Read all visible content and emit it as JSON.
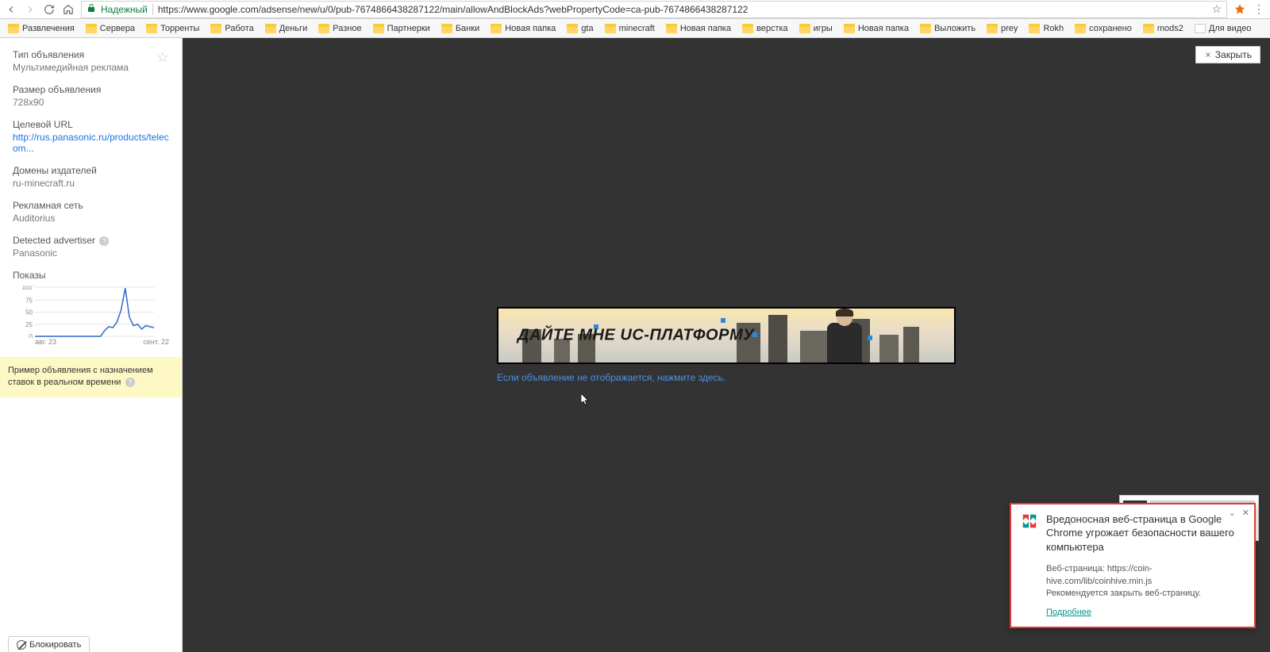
{
  "browser": {
    "secure_label": "Надежный",
    "url": "https://www.google.com/adsense/new/u/0/pub-7674866438287122/main/allowAndBlockAds?webPropertyCode=ca-pub-7674866438287122",
    "bookmarks": [
      "Развлечения",
      "Сервера",
      "Торренты",
      "Работа",
      "Деньги",
      "Разное",
      "Партнерки",
      "Банки",
      "Новая папка",
      "gta",
      "minecraft",
      "Новая папка",
      "верстка",
      "игры",
      "Новая папка",
      "Выложить",
      "prey",
      "Rokh",
      "сохранено",
      "mods2",
      "Для видео"
    ]
  },
  "sidebar": {
    "ad_type_label": "Тип объявления",
    "ad_type_value": "Мультимедийная реклама",
    "ad_size_label": "Размер объявления",
    "ad_size_value": "728x90",
    "target_url_label": "Целевой URL",
    "target_url_value": "http://rus.panasonic.ru/products/telecom...",
    "publisher_domains_label": "Домены издателей",
    "publisher_domains_value": "ru-minecraft.ru",
    "ad_network_label": "Рекламная сеть",
    "ad_network_value": "Auditorius",
    "detected_advertiser_label": "Detected advertiser",
    "detected_advertiser_value": "Panasonic",
    "impressions_label": "Показы",
    "note": "Пример объявления с назначением ставок в реальном времени",
    "chart_x_start": "авг. 23",
    "chart_x_end": "сент. 22"
  },
  "chart_data": {
    "type": "line",
    "title": "",
    "xlabel": "",
    "ylabel": "",
    "y_ticks": [
      102,
      75,
      50,
      25,
      0
    ],
    "ylim": [
      0,
      102
    ],
    "categories_label_start": "авг. 23",
    "categories_label_end": "сент. 22",
    "series": [
      {
        "name": "Показы",
        "values": [
          0,
          0,
          0,
          0,
          0,
          0,
          0,
          0,
          0,
          0,
          0,
          0,
          0,
          0,
          0,
          0,
          0,
          12,
          20,
          18,
          30,
          55,
          100,
          40,
          22,
          25,
          15,
          22,
          20,
          18
        ]
      }
    ]
  },
  "preview": {
    "close_label": "Закрыть",
    "ad_headline": "ДАЙТЕ МНЕ UC-ПЛАТФОРМУ",
    "fallback_link": "Если объявление не отображается, нажмите здесь."
  },
  "kaspersky": {
    "title": "Вредоносная веб-страница в Google Chrome угрожает безопасности вашего компьютера",
    "page_label": "Веб-страница: https://coin-hive.com/lib/coinhive.min.js",
    "advice": "Рекомендуется закрыть веб-страницу.",
    "more_link": "Подробнее"
  },
  "footer": {
    "block_button": "Блокировать"
  }
}
